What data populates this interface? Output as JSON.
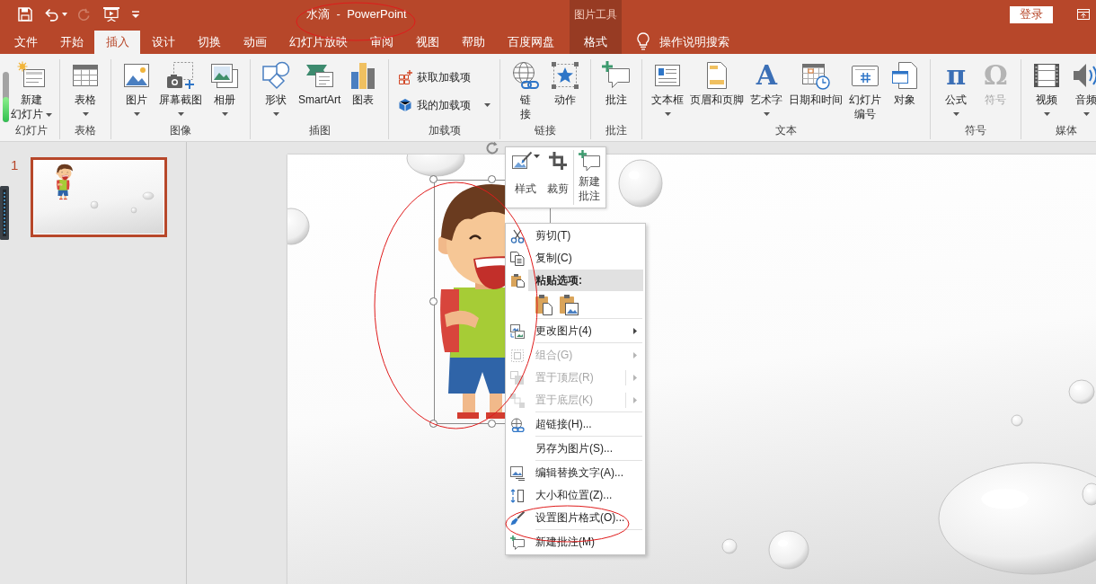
{
  "quick_access": [
    {
      "disabled": false
    },
    {
      "disabled": false
    },
    {
      "disabled": true
    },
    {
      "disabled": false
    }
  ],
  "window": {
    "title": "水滴  -  PowerPoint"
  },
  "contextual": {
    "label": "图片工具",
    "tabs": [
      {
        "label": "格式",
        "selected": false
      }
    ]
  },
  "account": {
    "sign_in": "登录"
  },
  "tabs": [
    {
      "label": "文件",
      "selected": false
    },
    {
      "label": "开始",
      "selected": false
    },
    {
      "label": "插入",
      "selected": true
    },
    {
      "label": "设计",
      "selected": false
    },
    {
      "label": "切换",
      "selected": false
    },
    {
      "label": "动画",
      "selected": false
    },
    {
      "label": "幻灯片放映",
      "selected": false
    },
    {
      "label": "审阅",
      "selected": false
    },
    {
      "label": "视图",
      "selected": false
    },
    {
      "label": "帮助",
      "selected": false
    },
    {
      "label": "百度网盘",
      "selected": false
    }
  ],
  "tell_me": {
    "placeholder": "操作说明搜索"
  },
  "ribbon": {
    "groups": [
      {
        "label": "幻灯片",
        "buttons": [
          {
            "kind": "split",
            "lines": [
              "新建",
              "幻灯片"
            ],
            "caret": true,
            "disabled": false
          }
        ]
      },
      {
        "label": "表格",
        "buttons": [
          {
            "kind": "large",
            "label": "表格",
            "caret": true,
            "disabled": false
          }
        ]
      },
      {
        "label": "图像",
        "buttons": [
          {
            "kind": "large",
            "label": "图片",
            "caret": true,
            "disabled": false
          },
          {
            "kind": "large",
            "label": "屏幕截图",
            "caret": true,
            "disabled": false
          },
          {
            "kind": "large",
            "label": "相册",
            "caret": true,
            "disabled": false
          }
        ]
      },
      {
        "label": "插图",
        "buttons": [
          {
            "kind": "large",
            "label": "形状",
            "caret": true,
            "disabled": false
          },
          {
            "kind": "large",
            "label": "SmartArt",
            "caret": false,
            "disabled": false
          },
          {
            "kind": "large",
            "label": "图表",
            "caret": false,
            "disabled": false
          }
        ]
      },
      {
        "label": "加载项",
        "buttons": [
          {
            "kind": "small",
            "label": "获取加载项",
            "caret": false,
            "disabled": false
          },
          {
            "kind": "small",
            "label": "我的加载项",
            "caret": true,
            "disabled": false
          }
        ]
      },
      {
        "label": "链接",
        "buttons": [
          {
            "kind": "large",
            "lines": [
              "链",
              "接"
            ],
            "caret": false,
            "disabled": false
          },
          {
            "kind": "large",
            "label": "动作",
            "caret": false,
            "disabled": false
          }
        ]
      },
      {
        "label": "批注",
        "buttons": [
          {
            "kind": "large",
            "label": "批注",
            "caret": false,
            "disabled": false
          }
        ]
      },
      {
        "label": "文本",
        "buttons": [
          {
            "kind": "large",
            "label": "文本框",
            "caret": true,
            "disabled": false
          },
          {
            "kind": "large",
            "label": "页眉和页脚",
            "caret": false,
            "disabled": false
          },
          {
            "kind": "glyph",
            "glyph": "A",
            "label": "艺术字",
            "caret": true,
            "disabled": false
          },
          {
            "kind": "large",
            "label": "日期和时间",
            "caret": false,
            "disabled": false
          },
          {
            "kind": "large",
            "lines": [
              "幻灯片",
              "编号"
            ],
            "caret": false,
            "disabled": false
          },
          {
            "kind": "large",
            "label": "对象",
            "caret": false,
            "disabled": false
          }
        ]
      },
      {
        "label": "符号",
        "buttons": [
          {
            "kind": "glyph",
            "glyph": "π",
            "label": "公式",
            "caret": true,
            "disabled": false
          },
          {
            "kind": "glyph",
            "glyph": "Ω",
            "label": "符号",
            "caret": false,
            "disabled": true
          }
        ]
      },
      {
        "label": "媒体",
        "buttons": [
          {
            "kind": "large",
            "label": "视频",
            "caret": true,
            "disabled": false
          },
          {
            "kind": "large",
            "label": "音频",
            "caret": true,
            "disabled": false
          }
        ]
      }
    ]
  },
  "side_meter": {
    "level": 0.5
  },
  "slides_pane": {
    "slides": [
      {
        "number": "1",
        "selected": true
      }
    ]
  },
  "slide": {
    "picture": {
      "selected": true
    }
  },
  "mini_toolbar": {
    "groups": [
      [
        {
          "label": "样式",
          "caret": true
        },
        {
          "label": "裁剪",
          "caret": false
        }
      ],
      [
        {
          "lines": [
            "新建",
            "批注"
          ],
          "caret": false
        }
      ]
    ]
  },
  "context_menu": {
    "items": [
      {
        "kind": "item",
        "label": "剪切(T)",
        "disabled": false,
        "submenu": false,
        "split": false
      },
      {
        "kind": "item",
        "label": "复制(C)",
        "disabled": false,
        "submenu": false,
        "split": false
      },
      {
        "kind": "header",
        "label": "粘贴选项:"
      },
      {
        "kind": "paste_options"
      },
      {
        "kind": "separator"
      },
      {
        "kind": "item",
        "label": "更改图片(4)",
        "disabled": false,
        "submenu": true,
        "split": false
      },
      {
        "kind": "separator"
      },
      {
        "kind": "item",
        "label": "组合(G)",
        "disabled": true,
        "submenu": true,
        "split": false
      },
      {
        "kind": "item",
        "label": "置于顶层(R)",
        "disabled": true,
        "submenu": true,
        "split": true
      },
      {
        "kind": "item",
        "label": "置于底层(K)",
        "disabled": true,
        "submenu": true,
        "split": true
      },
      {
        "kind": "separator"
      },
      {
        "kind": "item",
        "label": "超链接(H)...",
        "disabled": false,
        "submenu": false,
        "split": false
      },
      {
        "kind": "separator"
      },
      {
        "kind": "item",
        "label": "另存为图片(S)...",
        "disabled": false,
        "submenu": false,
        "split": false
      },
      {
        "kind": "separator"
      },
      {
        "kind": "item",
        "label": "编辑替换文字(A)...",
        "disabled": false,
        "submenu": false,
        "split": false
      },
      {
        "kind": "item",
        "label": "大小和位置(Z)...",
        "disabled": false,
        "submenu": false,
        "split": false
      },
      {
        "kind": "item",
        "label": "设置图片格式(O)...",
        "disabled": false,
        "submenu": false,
        "split": false
      },
      {
        "kind": "separator"
      },
      {
        "kind": "item",
        "label": "新建批注(M)",
        "disabled": false,
        "submenu": false,
        "split": false
      }
    ]
  }
}
